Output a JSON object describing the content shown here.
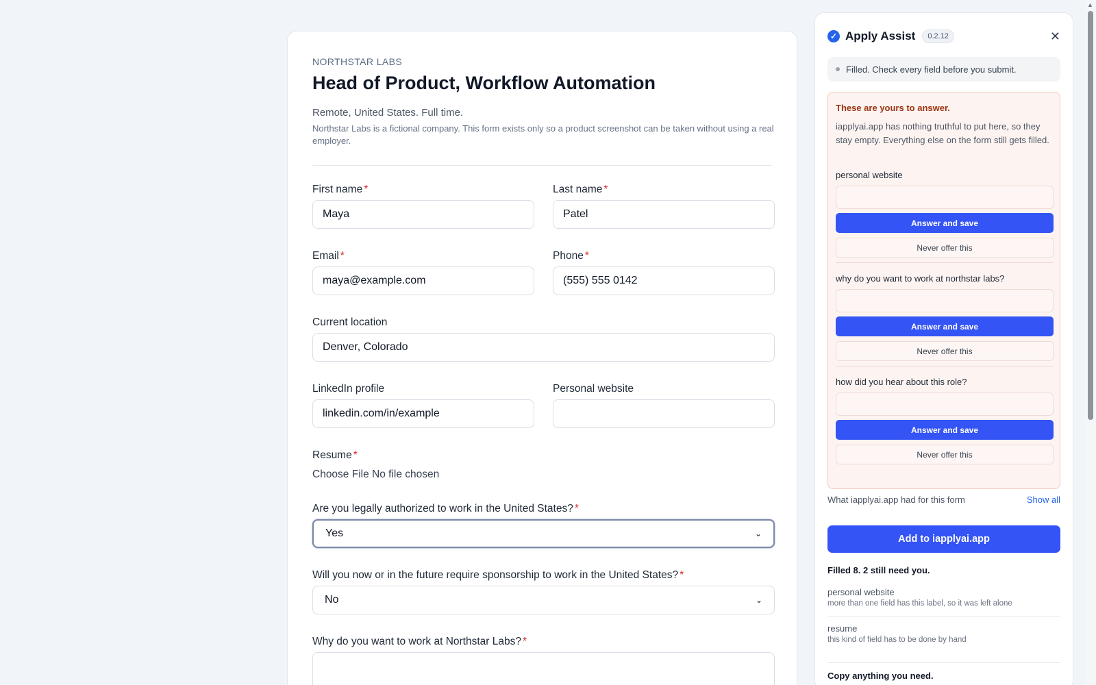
{
  "form": {
    "company": "NORTHSTAR LABS",
    "title": "Head of Product, Workflow Automation",
    "meta": "Remote, United States. Full time.",
    "description": "Northstar Labs is a fictional company. This form exists only so a product screenshot can be taken without using a real employer.",
    "required_mark": "*",
    "fields": {
      "first_name": {
        "label": "First name",
        "value": "Maya"
      },
      "last_name": {
        "label": "Last name",
        "value": "Patel"
      },
      "email": {
        "label": "Email",
        "value": "maya@example.com"
      },
      "phone": {
        "label": "Phone",
        "value": "(555) 555 0142"
      },
      "location": {
        "label": "Current location",
        "value": "Denver, Colorado"
      },
      "linkedin": {
        "label": "LinkedIn profile",
        "value": "linkedin.com/in/example"
      },
      "website": {
        "label": "Personal website",
        "value": ""
      },
      "resume": {
        "label": "Resume",
        "value": "Choose File No file chosen"
      },
      "authorized": {
        "label": "Are you legally authorized to work in the United States?",
        "value": "Yes"
      },
      "sponsorship": {
        "label": "Will you now or in the future require sponsorship to work in the United States?",
        "value": "No"
      },
      "why": {
        "label": "Why do you want to work at Northstar Labs?"
      }
    }
  },
  "panel": {
    "title": "Apply Assist",
    "version": "0.2.12",
    "status": "Filled. Check every field before you submit.",
    "warning_title": "These are yours to answer.",
    "warning_body": "iapplyai.app has nothing truthful to put here, so they stay empty. Everything else on the form still gets filled.",
    "questions": [
      {
        "label": "personal website",
        "primary": "Answer and save",
        "secondary": "Never offer this"
      },
      {
        "label": "why do you want to work at northstar labs?",
        "primary": "Answer and save",
        "secondary": "Never offer this"
      },
      {
        "label": "how did you hear about this role?",
        "primary": "Answer and save",
        "secondary": "Never offer this"
      }
    ],
    "had_label": "What iapplyai.app had for this form",
    "show_all": "Show all",
    "add_button": "Add to iapplyai.app",
    "filled_summary": "Filled 8. 2 still need you.",
    "skipped": [
      {
        "name": "personal website",
        "reason": "more than one field has this label, so it was left alone"
      },
      {
        "name": "resume",
        "reason": "this kind of field has to be done by hand"
      }
    ],
    "copy_label": "Copy anything you need.",
    "icons": {
      "check": "check-circle-icon",
      "close": "close-icon"
    },
    "accent": "#3454f5"
  }
}
